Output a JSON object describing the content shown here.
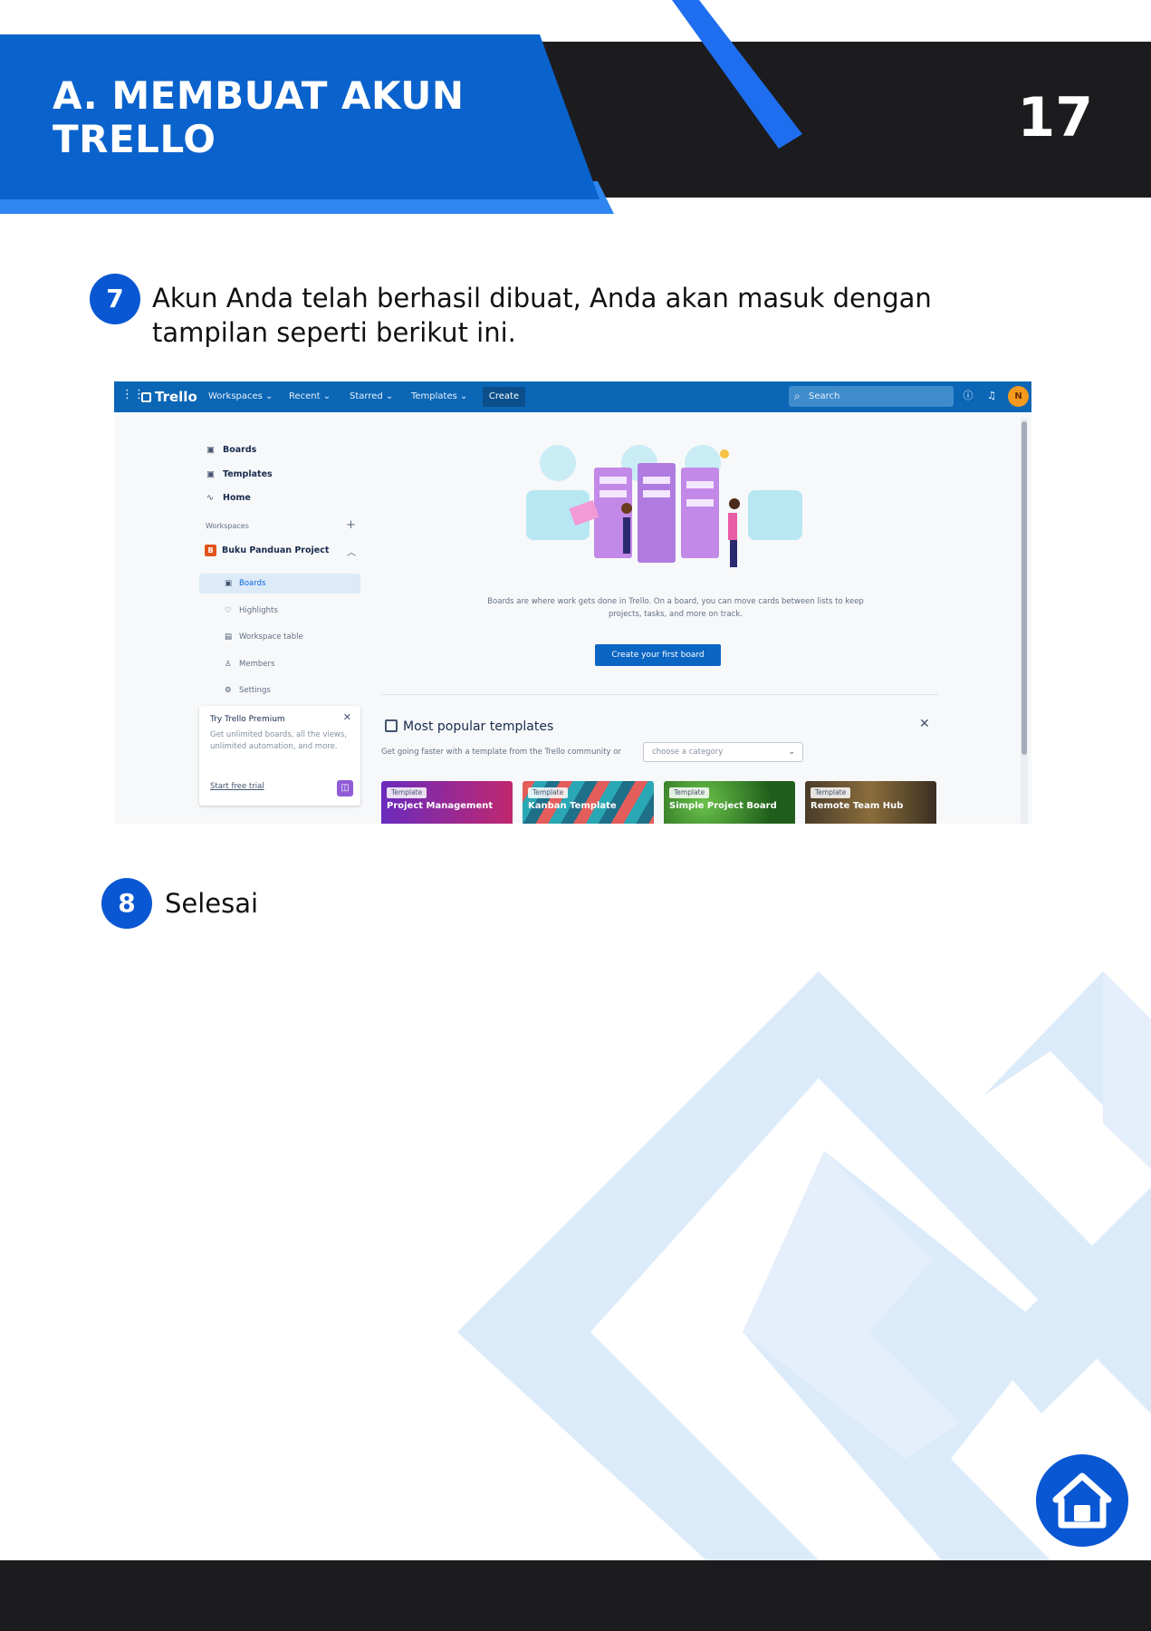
{
  "header": {
    "title": "A. MEMBUAT AKUN TRELLO",
    "page_number": "17"
  },
  "steps": [
    {
      "number": "7",
      "text": "Akun Anda telah berhasil dibuat, Anda akan masuk dengan tampilan seperti berikut ini."
    },
    {
      "number": "8",
      "text": "Selesai"
    }
  ],
  "trello": {
    "nav": {
      "logo": "Trello",
      "menus": [
        "Workspaces",
        "Recent",
        "Starred",
        "Templates"
      ],
      "create": "Create",
      "search_placeholder": "Search",
      "avatar": "N"
    },
    "sidebar": {
      "items": [
        "Boards",
        "Templates",
        "Home"
      ],
      "section_label": "Workspaces",
      "workspace_name": "Buku Panduan Project",
      "workspace_initial": "B",
      "sub_items": [
        "Boards",
        "Highlights",
        "Workspace table",
        "Members",
        "Settings"
      ],
      "promo": {
        "title": "Try Trello Premium",
        "desc": "Get unlimited boards, all the views, unlimited automation, and more.",
        "link": "Start free trial"
      }
    },
    "main": {
      "description": "Boards are where work gets done in Trello. On a board, you can move cards between lists to keep projects, tasks, and more on track.",
      "cta": "Create your first board",
      "templates_heading": "Most popular templates",
      "templates_subtitle": "Get going faster with a template from the Trello community or",
      "category_placeholder": "choose a category",
      "templates": [
        {
          "tag": "Template",
          "name": "Project Management"
        },
        {
          "tag": "Template",
          "name": "Kanban Template"
        },
        {
          "tag": "Template",
          "name": "Simple Project Board"
        },
        {
          "tag": "Template",
          "name": "Remote Team Hub"
        }
      ]
    }
  },
  "colors": {
    "brand_blue": "#0a57d4",
    "header_dark": "#1c1c1e",
    "trello_nav": "#0b66b5",
    "deco_light": "#dcebfa"
  },
  "icons": {
    "home_button": "home-icon"
  }
}
